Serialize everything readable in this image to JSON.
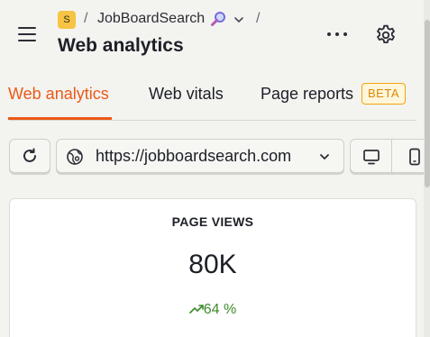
{
  "header": {
    "project_initial": "S",
    "breadcrumb_separator": "/",
    "project_name": "JobBoardSearch",
    "title": "Web analytics"
  },
  "tabs": [
    {
      "label": "Web analytics",
      "active": true
    },
    {
      "label": "Web vitals",
      "active": false
    },
    {
      "label": "Page reports",
      "active": false,
      "badge": "BETA"
    }
  ],
  "controls": {
    "url_value": "https://jobboardsearch.com"
  },
  "card": {
    "title": "PAGE VIEWS",
    "value": "80K",
    "change": "64 %"
  },
  "icons": {
    "menu": "hamburger-icon",
    "emoji": "magnifying-glass-icon",
    "more": "more-dots-icon",
    "settings": "gear-icon",
    "refresh": "refresh-icon",
    "url": "globe-icon",
    "desktop": "desktop-icon",
    "mobile": "mobile-icon",
    "trend": "trending-up-icon"
  },
  "colors": {
    "accent": "#ea5a18",
    "badge": "#f6c343",
    "beta": "#f2a50c",
    "positive": "#3e8b2c"
  }
}
